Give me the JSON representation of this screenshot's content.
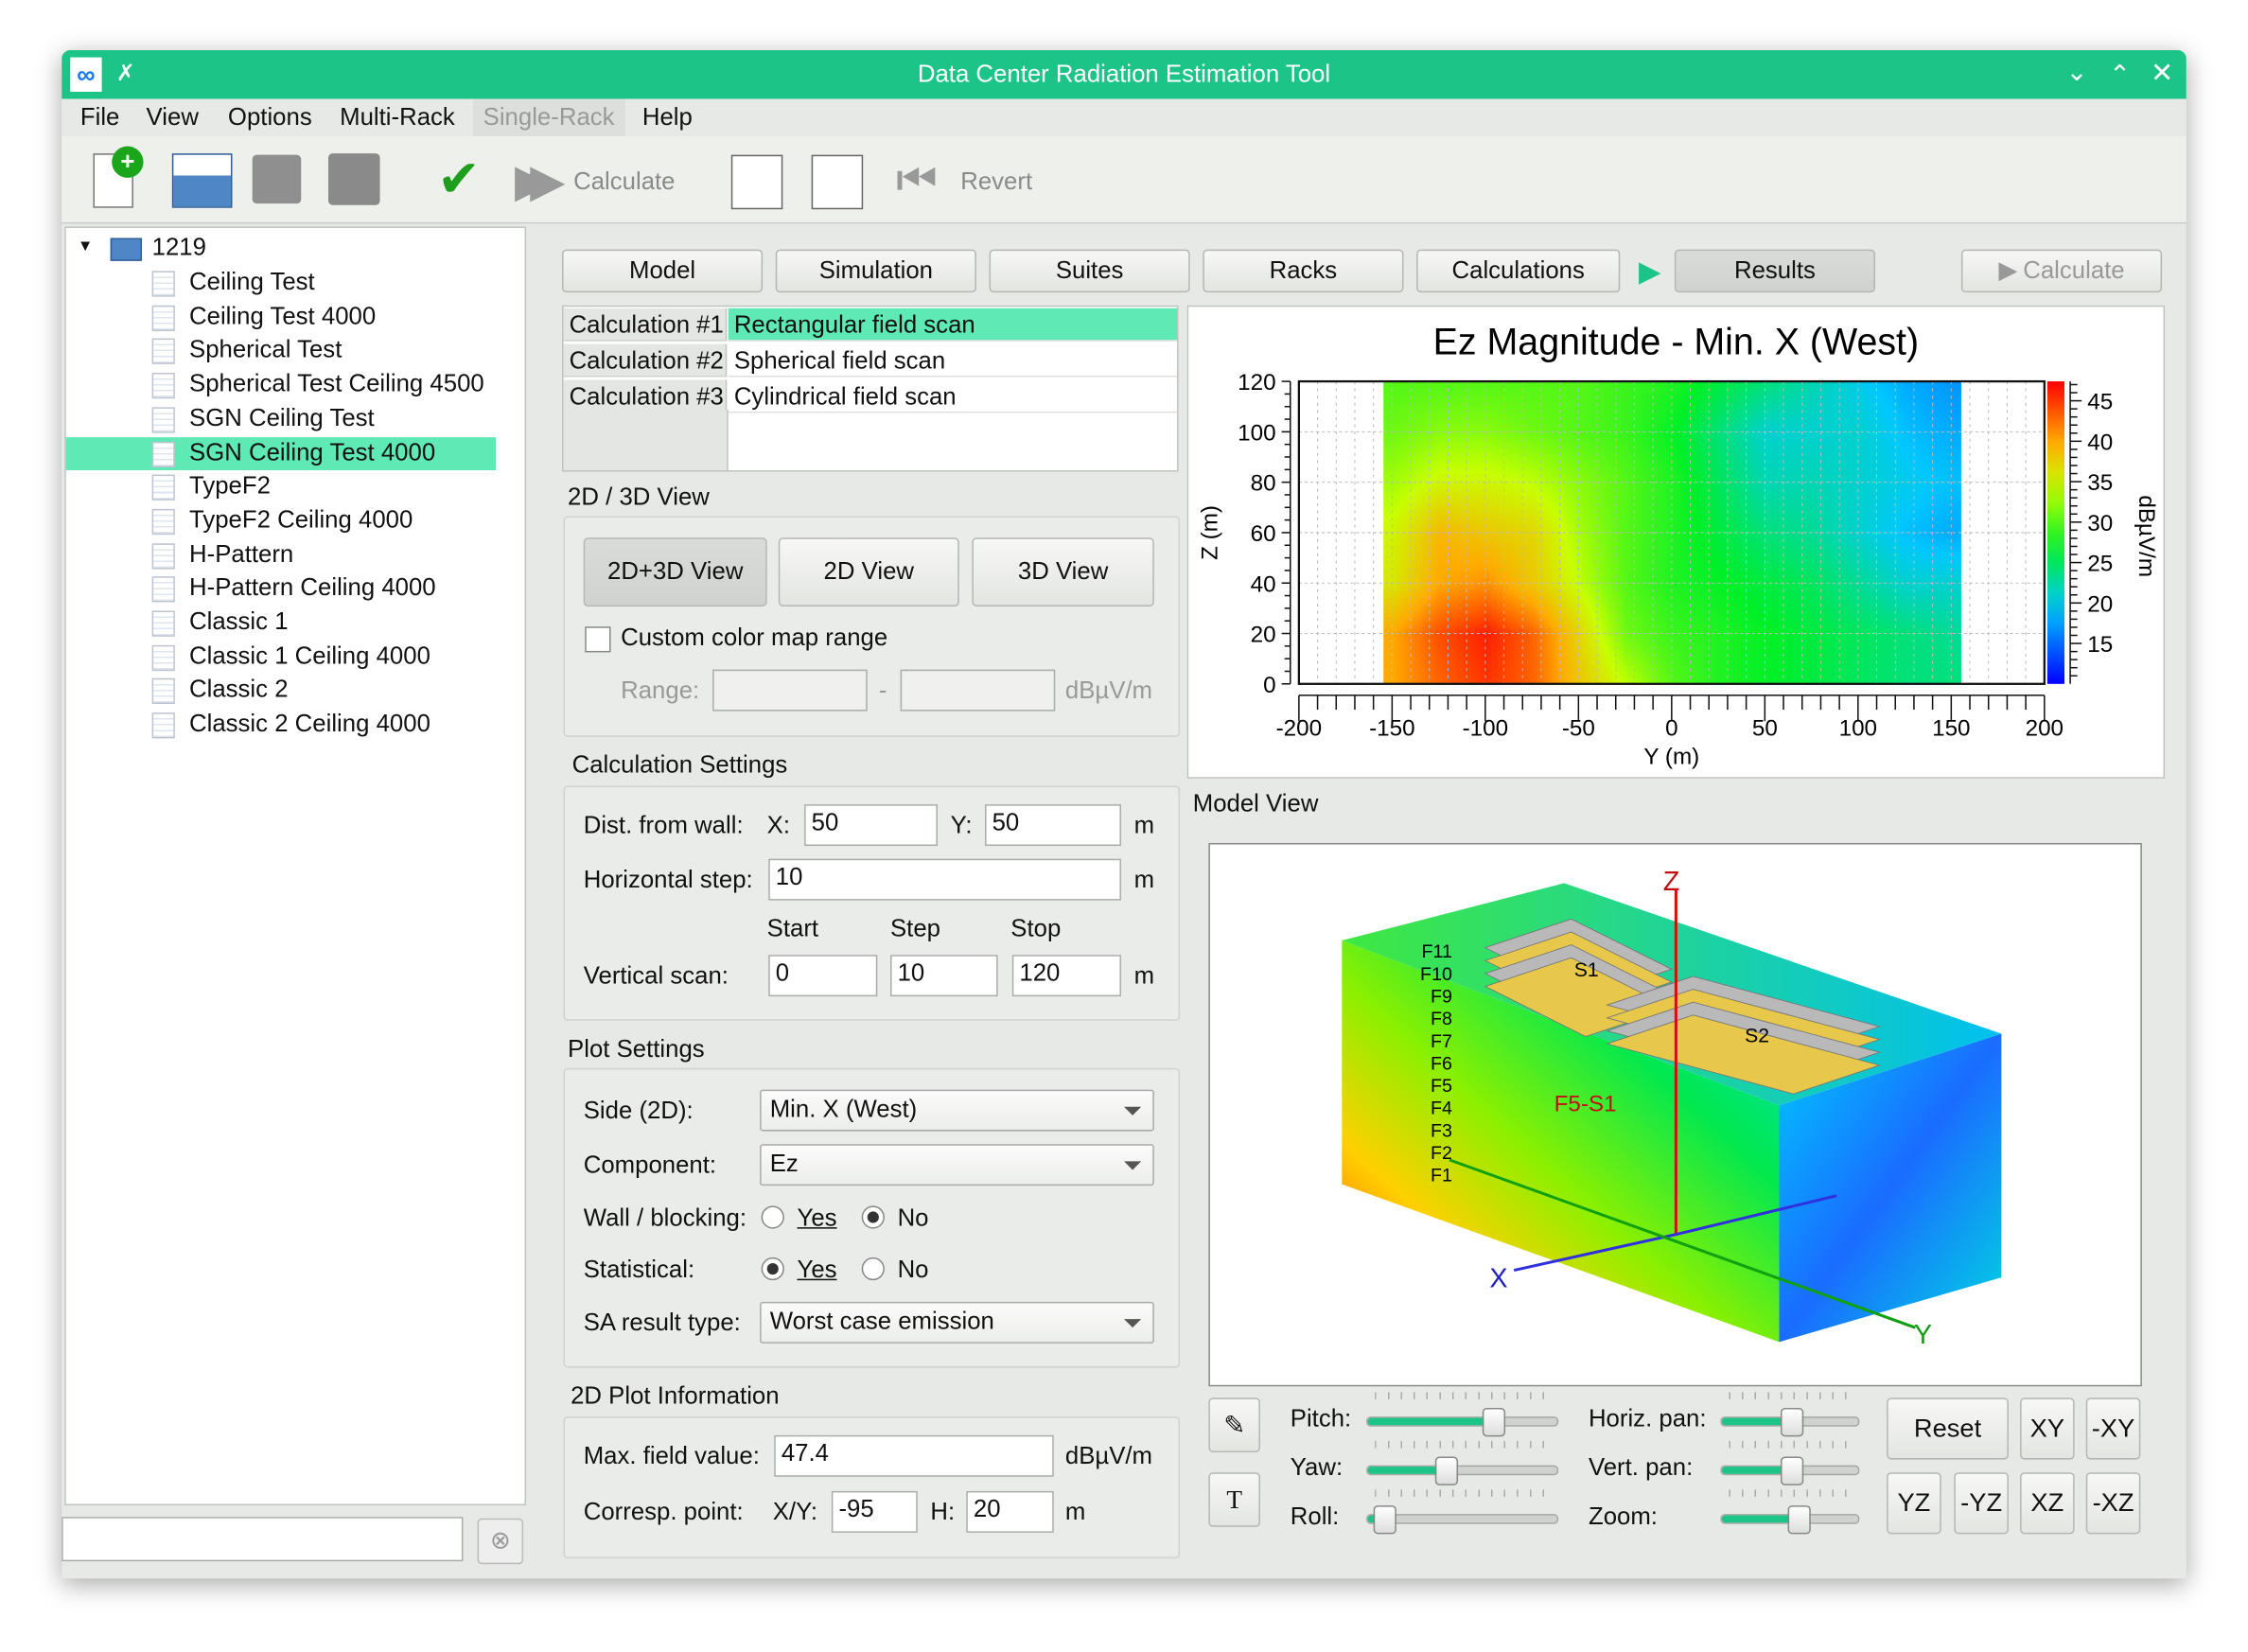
{
  "window": {
    "title": "Data Center Radiation Estimation Tool",
    "accent": "#1cc488",
    "selection": "#5ee9b5"
  },
  "menu": [
    "File",
    "View",
    "Options",
    "Multi-Rack",
    "Single-Rack",
    "Help"
  ],
  "toolbar": {
    "calculate": "Calculate",
    "revert": "Revert"
  },
  "tree": {
    "root": "1219",
    "items": [
      "Ceiling Test",
      "Ceiling Test 4000",
      "Spherical Test",
      "Spherical Test Ceiling 4500",
      "SGN Ceiling Test",
      "SGN Ceiling Test 4000",
      "TypeF2",
      "TypeF2 Ceiling 4000",
      "H-Pattern",
      "H-Pattern Ceiling 4000",
      "Classic 1",
      "Classic 1 Ceiling 4000",
      "Classic 2",
      "Classic 2 Ceiling 4000"
    ],
    "selected": "SGN Ceiling Test 4000",
    "search_value": ""
  },
  "tabs": [
    "Model",
    "Simulation",
    "Suites",
    "Racks",
    "Calculations",
    "Results"
  ],
  "active_tab": "Results",
  "calculate_button": "Calculate",
  "calculations": [
    {
      "id": "Calculation #1",
      "name": "Rectangular field scan"
    },
    {
      "id": "Calculation #2",
      "name": "Spherical field scan"
    },
    {
      "id": "Calculation #3",
      "name": "Cylindrical field scan"
    }
  ],
  "view2d3d": {
    "heading": "2D / 3D View",
    "buttons": [
      "2D+3D View",
      "2D View",
      "3D View"
    ],
    "custom_range_label": "Custom color map range",
    "range_label": "Range:",
    "range_min": "",
    "range_max": "",
    "range_sep": "-",
    "unit": "dBµV/m"
  },
  "calc_settings": {
    "heading": "Calculation Settings",
    "dist_label": "Dist. from wall:",
    "x_label": "X:",
    "x_value": "50",
    "y_label": "Y:",
    "y_value": "50",
    "unit": "m",
    "hstep_label": "Horizontal step:",
    "hstep_value": "10",
    "start_label": "Start",
    "step_label": "Step",
    "stop_label": "Stop",
    "vscan_label": "Vertical scan:",
    "vstart": "0",
    "vstep": "10",
    "vstop": "120"
  },
  "plot_settings": {
    "heading": "Plot Settings",
    "side_label": "Side (2D):",
    "side_value": "Min. X (West)",
    "component_label": "Component:",
    "component_value": "Ez",
    "wall_label": "Wall / blocking:",
    "yes": "Yes",
    "no": "No",
    "wall_value": "No",
    "stat_label": "Statistical:",
    "stat_value": "Yes",
    "sa_label": "SA result type:",
    "sa_value": "Worst case emission"
  },
  "plot_info": {
    "heading": "2D Plot Information",
    "max_label": "Max. field value:",
    "max_value": "47.4",
    "unit": "dBµV/m",
    "point_label": "Corresp. point:",
    "xy_label": "X/Y:",
    "xy_value": "-95",
    "h_label": "H:",
    "h_value": "20",
    "h_unit": "m"
  },
  "chart_data": {
    "type": "heatmap",
    "title": "Ez Magnitude - Min. X (West)",
    "xlabel": "Y (m)",
    "ylabel": "Z (m)",
    "colorbar_label": "dBµV/m",
    "xlim": [
      -200,
      200
    ],
    "ylim": [
      0,
      120
    ],
    "xticks": [
      -200,
      -150,
      -100,
      -50,
      0,
      50,
      100,
      150,
      200
    ],
    "yticks": [
      0,
      20,
      40,
      60,
      80,
      100,
      120
    ],
    "colorbar_ticks": [
      15,
      20,
      25,
      30,
      35,
      40,
      45
    ],
    "color_range": [
      10,
      47.4
    ],
    "colormap": "jet",
    "grid": true,
    "data_y_extent": [
      -155,
      155
    ],
    "y": [
      -150,
      -125,
      -100,
      -75,
      -50,
      -25,
      0,
      25,
      50,
      75,
      100,
      125,
      150
    ],
    "z": [
      0,
      20,
      40,
      60,
      80,
      100,
      120
    ],
    "values": [
      [
        40,
        43,
        45,
        43,
        38,
        34,
        30,
        28,
        27,
        26,
        25,
        24,
        24
      ],
      [
        40,
        44,
        46,
        43,
        37,
        31,
        29,
        28,
        27,
        26,
        25,
        24,
        23
      ],
      [
        36,
        40,
        41,
        38,
        34,
        30,
        28,
        27,
        26,
        25,
        23,
        21,
        21
      ],
      [
        35,
        39,
        38,
        37,
        33,
        30,
        28,
        26,
        24,
        23,
        21,
        19,
        18
      ],
      [
        33,
        35,
        35,
        34,
        32,
        30,
        28,
        25,
        22,
        22,
        21,
        20,
        19
      ],
      [
        31,
        32,
        32,
        31,
        30,
        29,
        27,
        24,
        21,
        21,
        21,
        19,
        18
      ],
      [
        30,
        30,
        30,
        30,
        30,
        29,
        28,
        26,
        24,
        22,
        20,
        18,
        17
      ]
    ]
  },
  "model_view": {
    "heading": "Model View",
    "floors": [
      "F11",
      "F10",
      "F9",
      "F8",
      "F7",
      "F6",
      "F5",
      "F4",
      "F3",
      "F2",
      "F1"
    ],
    "suites": [
      "S1",
      "S2"
    ],
    "highlight": "F5-S1",
    "axes": [
      "X",
      "Y",
      "Z"
    ]
  },
  "controls": {
    "pitch_label": "Pitch:",
    "yaw_label": "Yaw:",
    "roll_label": "Roll:",
    "hpan_label": "Horiz. pan:",
    "vpan_label": "Vert. pan:",
    "zoom_label": "Zoom:",
    "pitch": 0.66,
    "yaw": 0.41,
    "roll": 0.08,
    "hpan": 0.5,
    "vpan": 0.5,
    "zoom": 0.56,
    "reset": "Reset",
    "views": [
      "XY",
      "-XY",
      "YZ",
      "-YZ",
      "XZ",
      "-XZ"
    ],
    "text_button": "T"
  }
}
